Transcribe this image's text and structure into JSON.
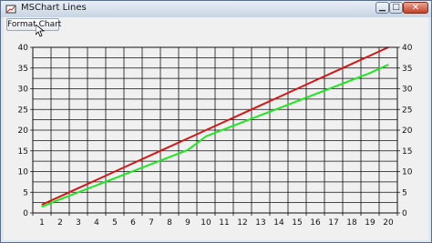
{
  "window": {
    "title": "MSChart Lines",
    "icons": {
      "app": "app-icon",
      "minimize": "minimize-icon",
      "maximize": "maximize-icon",
      "close": "close-icon"
    }
  },
  "toolbar": {
    "format_label": "Format Chart"
  },
  "colors": {
    "series_1": "#d01818",
    "series_2": "#22e622",
    "grid": "#111111",
    "plot_bg": "#f0f0f0"
  },
  "chart_data": {
    "type": "line",
    "x": [
      1,
      2,
      3,
      4,
      5,
      6,
      7,
      8,
      9,
      10,
      11,
      12,
      13,
      14,
      15,
      16,
      17,
      18,
      19,
      20
    ],
    "series": [
      {
        "values": [
          2,
          4,
          6,
          8,
          10,
          12,
          14,
          16,
          18,
          20,
          22,
          24,
          26,
          28,
          30,
          32,
          34,
          36,
          38,
          40
        ]
      },
      {
        "values": [
          1.5,
          3.3,
          5.0,
          6.7,
          8.4,
          10.1,
          11.8,
          13.5,
          15.2,
          18.5,
          20.2,
          21.9,
          23.6,
          25.3,
          27.0,
          28.7,
          30.4,
          32.1,
          33.8,
          35.8
        ]
      }
    ],
    "x_ticks": [
      "1",
      "2",
      "3",
      "4",
      "5",
      "6",
      "7",
      "8",
      "9",
      "10",
      "11",
      "12",
      "13",
      "14",
      "15",
      "16",
      "17",
      "18",
      "19",
      "20"
    ],
    "y_ticks": [
      "0",
      "5",
      "10",
      "15",
      "20",
      "25",
      "30",
      "35",
      "40"
    ],
    "y2_ticks": [
      "0",
      "5",
      "10",
      "15",
      "20",
      "25",
      "30",
      "35",
      "40"
    ],
    "xlim": [
      0.5,
      20.5
    ],
    "ylim": [
      0,
      40
    ],
    "grid": true
  }
}
